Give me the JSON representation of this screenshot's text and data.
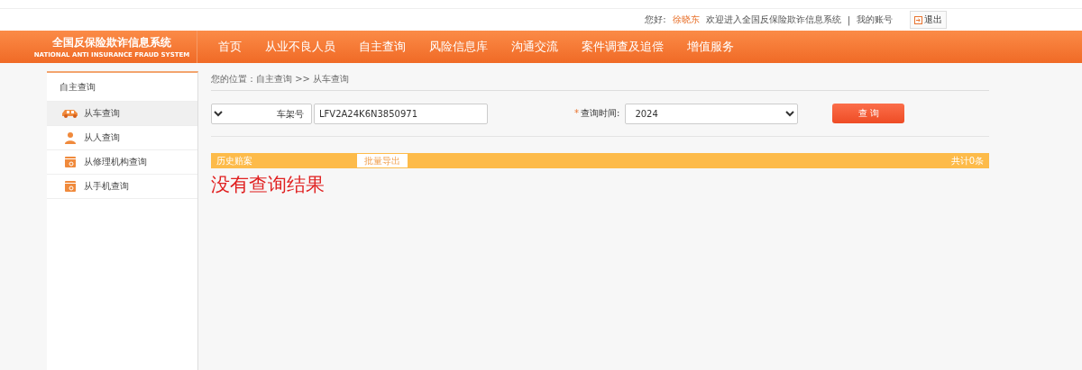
{
  "top_bar": {
    "greeting": "您好:",
    "user": "徐晓东",
    "welcome": "欢迎进入全国反保险欺诈信息系统",
    "separator": "|",
    "account_link": "我的账号",
    "logout": "退出"
  },
  "logo": {
    "title": "全国反保险欺诈信息系统",
    "subtitle": "NATIONAL ANTI INSURANCE FRAUD SYSTEM"
  },
  "nav": [
    {
      "label": "首页"
    },
    {
      "label": "从业不良人员"
    },
    {
      "label": "自主查询"
    },
    {
      "label": "风险信息库"
    },
    {
      "label": "沟通交流"
    },
    {
      "label": "案件调查及追偿"
    },
    {
      "label": "增值服务"
    }
  ],
  "sidebar": {
    "title": "自主查询",
    "items": [
      {
        "label": "从车查询",
        "kind": "car",
        "selected": true
      },
      {
        "label": "从人查询",
        "kind": "person",
        "selected": false
      },
      {
        "label": "从修理机构查询",
        "kind": "card",
        "selected": false
      },
      {
        "label": "从手机查询",
        "kind": "card",
        "selected": false
      }
    ]
  },
  "breadcrumb": "您的位置：自主查询 >> 从车查询",
  "form": {
    "type_select": "车架号",
    "vin_value": "LFV2A24K6N3850971",
    "time_label": "查询时间:",
    "required_mark": "*",
    "time_value": "2024",
    "search_button": "查 询"
  },
  "results": {
    "title": "历史赔案",
    "export_button": "批量导出",
    "count": "共计0条",
    "empty_message": "没有查询结果"
  }
}
